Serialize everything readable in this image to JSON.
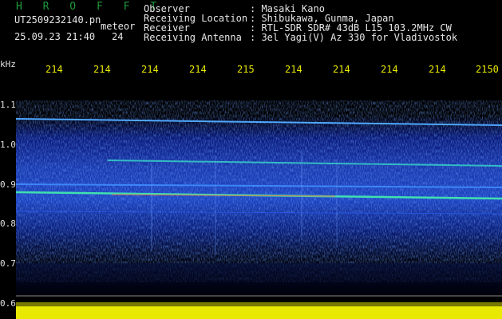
{
  "header": {
    "logo": "H R O F F T",
    "file_name": "UT2509232140.pn",
    "tag": "meteor",
    "date_time": "25.09.23 21:40",
    "seq": "24",
    "fields": [
      {
        "label": "Observer",
        "value": ": Masaki Kano"
      },
      {
        "label": "Receiving Location",
        "value": ": Shibukawa, Gunma, Japan"
      },
      {
        "label": "Receiver",
        "value": ": RTL-SDR SDR# 43dB L15 103.2MHz CW"
      },
      {
        "label": "Receiving Antenna",
        "value": ": 3el Yagi(V) Az 330 for Vladivostok"
      }
    ]
  },
  "axes": {
    "y_unit": "kHz",
    "y_ticks": [
      "1.1",
      "1.0",
      "0.9",
      "0.8",
      "0.7",
      "0.6"
    ],
    "x_ticks": [
      "214",
      "214",
      "214",
      "214",
      "215",
      "214",
      "214",
      "214",
      "214",
      "2150"
    ]
  },
  "colors": {
    "background": "#000000",
    "header_text": "#e6e6e6",
    "logo": "#1f9a3a",
    "x_axis_labels": "#e8e800",
    "signal_bar": "#e8e800"
  }
}
